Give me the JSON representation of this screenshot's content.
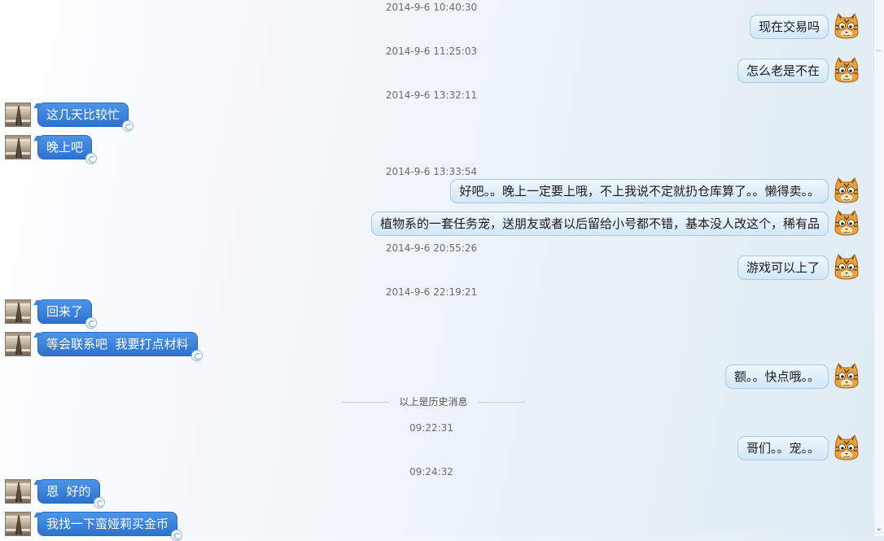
{
  "history_divider": "以上是历史消息",
  "messages": [
    {
      "type": "timestamp",
      "text": "2014-9-6 10:40:30"
    },
    {
      "type": "out",
      "text": "现在交易吗"
    },
    {
      "type": "timestamp",
      "text": "2014-9-6 11:25:03"
    },
    {
      "type": "out",
      "text": "怎么老是不在"
    },
    {
      "type": "timestamp",
      "text": "2014-9-6 13:32:11"
    },
    {
      "type": "in",
      "text": "这几天比较忙"
    },
    {
      "type": "in",
      "text": "晚上吧"
    },
    {
      "type": "timestamp",
      "text": "2014-9-6 13:33:54"
    },
    {
      "type": "out",
      "text": "好吧。。晚上一定要上哦，不上我说不定就扔仓库算了。。懒得卖。。"
    },
    {
      "type": "out",
      "text": "植物系的一套任务宠，送朋友或者以后留给小号都不错，基本没人改这个，稀有品"
    },
    {
      "type": "timestamp",
      "text": "2014-9-6 20:55:26"
    },
    {
      "type": "out",
      "text": "游戏可以上了"
    },
    {
      "type": "timestamp",
      "text": "2014-9-6 22:19:21"
    },
    {
      "type": "in",
      "text": "回来了"
    },
    {
      "type": "in",
      "text": "等会联系吧  我要打点材料"
    },
    {
      "type": "out",
      "text": "额。。快点哦。。"
    },
    {
      "type": "timestamp",
      "text": "09:22:31"
    },
    {
      "type": "out",
      "text": "哥们。。宠。。"
    },
    {
      "type": "timestamp",
      "text": "09:24:32"
    },
    {
      "type": "in",
      "text": "恩  好的"
    },
    {
      "type": "in",
      "text": "我找一下蛮娅莉买金币"
    }
  ],
  "colors": {
    "incoming_bubble": "#3a82dc",
    "outgoing_bubble": "#dcecf8",
    "timestamp_text": "#6b6b6b"
  },
  "icons": {
    "self_avatar": "tiger-avatar-icon",
    "contact_avatar": "eiffel-tower-avatar-icon",
    "scroll_down": "chevron-down-icon"
  }
}
